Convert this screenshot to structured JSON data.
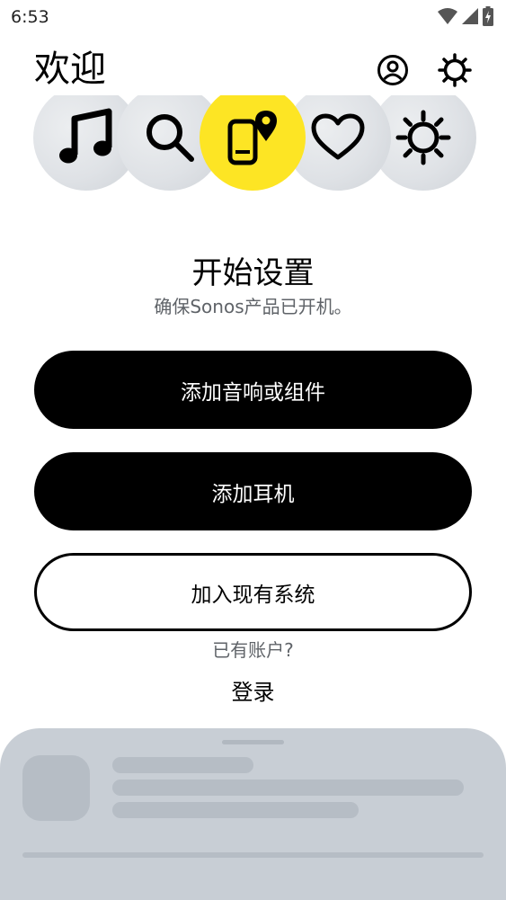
{
  "status_bar": {
    "time": "6:53",
    "icons": [
      "wifi-icon",
      "signal-icon",
      "battery-charging-icon"
    ]
  },
  "header": {
    "title": "欢迎",
    "icons": [
      "account-icon",
      "settings-icon"
    ]
  },
  "carousel": {
    "items": [
      {
        "icon": "music-note-icon",
        "active": false
      },
      {
        "icon": "search-icon",
        "active": false
      },
      {
        "icon": "phone-location-icon",
        "active": true
      },
      {
        "icon": "heart-icon",
        "active": false
      },
      {
        "icon": "sun-icon",
        "active": false
      }
    ],
    "accent_color": "#fde524"
  },
  "setup": {
    "title": "开始设置",
    "subtitle": "确保Sonos产品已开机。"
  },
  "buttons": {
    "add_speaker": "添加音响或组件",
    "add_headphones": "添加耳机",
    "join_system": "加入现有系统"
  },
  "account": {
    "question": "已有账户?",
    "signin": "登录"
  },
  "colors": {
    "primary": "#000000",
    "sheet": "#c8ced5",
    "muted_text": "#5f6368"
  }
}
